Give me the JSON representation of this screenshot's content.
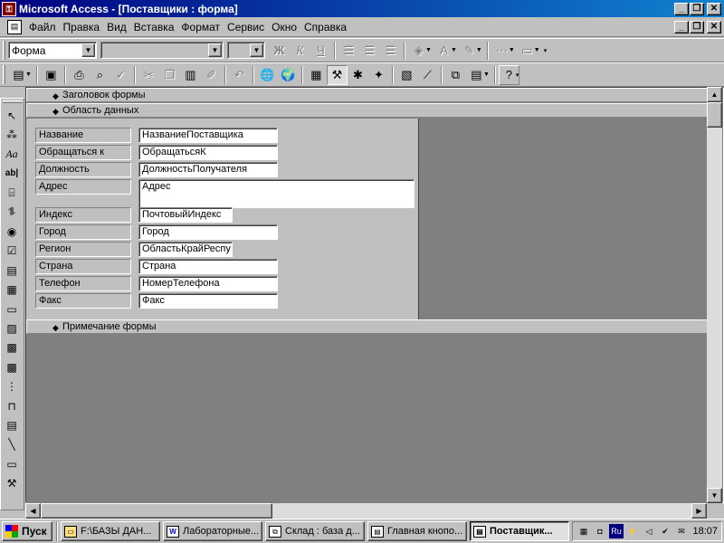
{
  "window": {
    "title": "Microsoft Access - [Поставщики : форма]",
    "app_icon": "access-key-icon"
  },
  "caption_buttons": {
    "minimize": "_",
    "restore": "❐",
    "close": "✕"
  },
  "menu": {
    "items": [
      "Файл",
      "Правка",
      "Вид",
      "Вставка",
      "Формат",
      "Сервис",
      "Окно",
      "Справка"
    ]
  },
  "toolbar_formatting": {
    "object_combo": "Форма",
    "font_combo": "",
    "size_combo": "",
    "bold": "Ж",
    "italic": "К",
    "underline": "Ч"
  },
  "toolbox": {
    "tools": [
      "select-pointer-icon",
      "wizard-wand-icon",
      "label-tool-icon",
      "textbox-tool-icon",
      "option-group-icon",
      "toggle-button-icon",
      "option-button-icon",
      "checkbox-icon",
      "combobox-icon",
      "listbox-icon",
      "command-button-icon",
      "image-icon",
      "unbound-frame-icon",
      "bound-frame-icon",
      "page-break-icon",
      "tab-control-icon",
      "subform-icon",
      "line-icon",
      "rectangle-icon",
      "more-controls-icon"
    ]
  },
  "form": {
    "sections": {
      "header": "Заголовок формы",
      "detail": "Область данных",
      "footer": "Примечание формы"
    },
    "fields": [
      {
        "label": "Название",
        "control": "НазваниеПоставщика"
      },
      {
        "label": "Обращаться к",
        "control": "ОбращатьсяК"
      },
      {
        "label": "Должность",
        "control": "ДолжностьПолучателя"
      },
      {
        "label": "Адрес",
        "control": "Адрес"
      },
      {
        "label": "Индекс",
        "control": "ПочтовыйИндекс"
      },
      {
        "label": "Город",
        "control": "Город"
      },
      {
        "label": "Регион",
        "control": "ОбластьКрайРеспу"
      },
      {
        "label": "Страна",
        "control": "Страна"
      },
      {
        "label": "Телефон",
        "control": "НомерТелефона"
      },
      {
        "label": "Факс",
        "control": "Факс"
      }
    ]
  },
  "taskbar": {
    "start_label": "Пуск",
    "tasks": [
      {
        "label": "F:\\БАЗЫ ДАН...",
        "icon": "folder-icon",
        "active": false
      },
      {
        "label": "Лабораторные...",
        "icon": "word-icon",
        "active": false
      },
      {
        "label": "Склад : база д...",
        "icon": "database-window-icon",
        "active": false
      },
      {
        "label": "Главная кнопо...",
        "icon": "form-icon",
        "active": false
      },
      {
        "label": "Поставщик...",
        "icon": "form-icon",
        "active": true
      }
    ],
    "tray": {
      "language": "Ru",
      "clock": "18:07"
    }
  }
}
